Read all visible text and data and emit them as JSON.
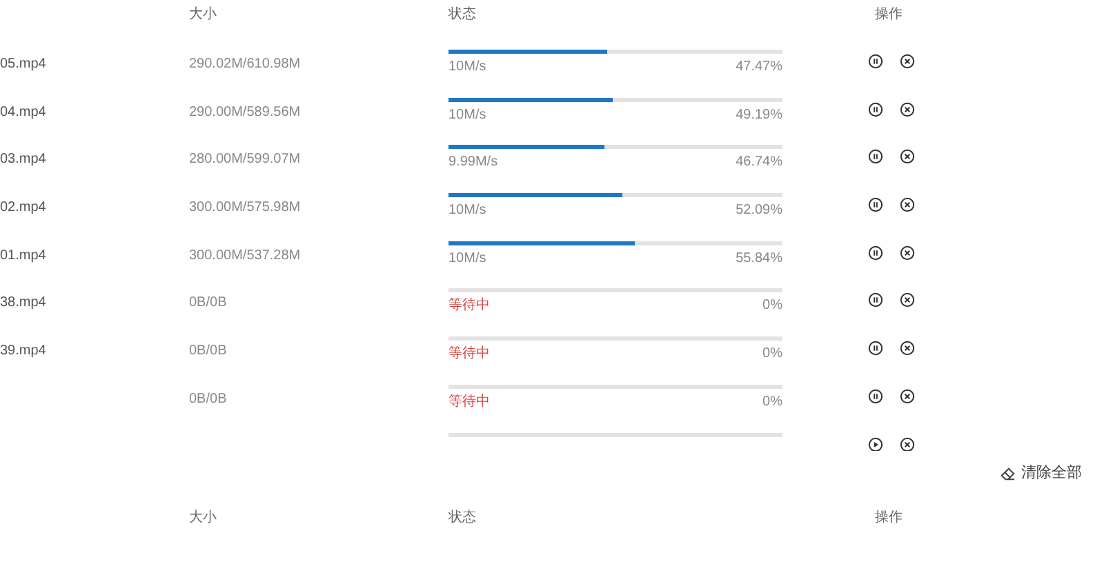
{
  "columns": [
    "大小",
    "状态",
    "操作"
  ],
  "rows": [
    {
      "name": "05.mp4",
      "size": "290.02M/610.98M",
      "kind": "speed",
      "status": "10M/s",
      "level": 0.4747,
      "percent": "47.47%",
      "paused": false
    },
    {
      "name": "04.mp4",
      "size": "290.00M/589.56M",
      "kind": "speed",
      "status": "10M/s",
      "level": 0.4919,
      "percent": "49.19%",
      "paused": false
    },
    {
      "name": "03.mp4",
      "size": "280.00M/599.07M",
      "kind": "speed",
      "status": "9.99M/s",
      "level": 0.4674,
      "percent": "46.74%",
      "paused": false
    },
    {
      "name": "02.mp4",
      "size": "300.00M/575.98M",
      "kind": "speed",
      "status": "10M/s",
      "level": 0.5209,
      "percent": "52.09%",
      "paused": false
    },
    {
      "name": "01.mp4",
      "size": "300.00M/537.28M",
      "kind": "speed",
      "status": "10M/s",
      "level": 0.5584,
      "percent": "55.84%",
      "paused": false
    },
    {
      "name": "38.mp4",
      "size": "0B/0B",
      "kind": "waiting",
      "status": "等待中",
      "level": 0,
      "percent": "0%",
      "paused": false
    },
    {
      "name": "39.mp4",
      "size": "0B/0B",
      "kind": "waiting",
      "status": "等待中",
      "level": 0,
      "percent": "0%",
      "paused": false
    },
    {
      "size": "0B/0B",
      "kind": "waiting",
      "status": "等待中",
      "level": 0,
      "percent": "0%",
      "paused": false
    },
    {
      "paused": true,
      "level": 0
    }
  ],
  "clear_all": "清除全部",
  "columns_2": [
    "大小",
    "状态",
    "操作"
  ]
}
